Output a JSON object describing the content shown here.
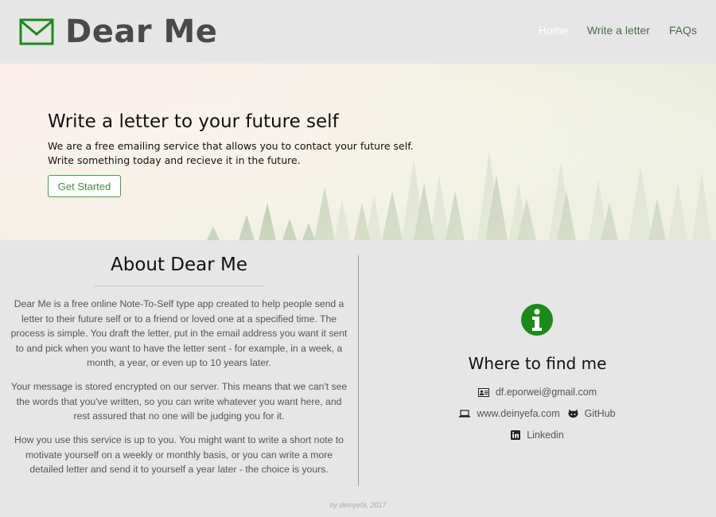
{
  "app": {
    "brand": "Dear Me",
    "accent_color": "#1a8a1a"
  },
  "nav": {
    "items": [
      {
        "label": "Home"
      },
      {
        "label": "Write a letter"
      },
      {
        "label": "FAQs"
      }
    ]
  },
  "hero": {
    "title": "Write a letter to your future self",
    "line1": "We are a free emailing service that allows you to contact your future self.",
    "line2": "Write something today and recieve it in the future.",
    "cta_label": "Get Started"
  },
  "about": {
    "title": "About Dear Me",
    "paragraphs": [
      "Dear Me is a free online Note-To-Self type app created to help people send a letter to their future self or to a friend or loved one at a specified time. The process is simple. You draft the letter, put in the email address you want it sent to and pick when you want to have the letter sent - for example, in a week, a month, a year, or even up to 10 years later.",
      "Your message is stored encrypted on our server. This means that we can't see the words that you've written, so you can write whatever you want here, and rest assured that no one will be judging you for it.",
      "How you use this service is up to you. You might want to write a short note to motivate yourself on a weekly or monthly basis, or you can write a more detailed letter and send it to yourself a year later - the choice is yours."
    ]
  },
  "contact": {
    "title": "Where to find me",
    "email": "df.eporwei@gmail.com",
    "website": "www.deinyefa.com",
    "github": "GitHub",
    "linkedin": "Linkedin"
  },
  "footer": {
    "text": "by deinyefa, 2017"
  }
}
